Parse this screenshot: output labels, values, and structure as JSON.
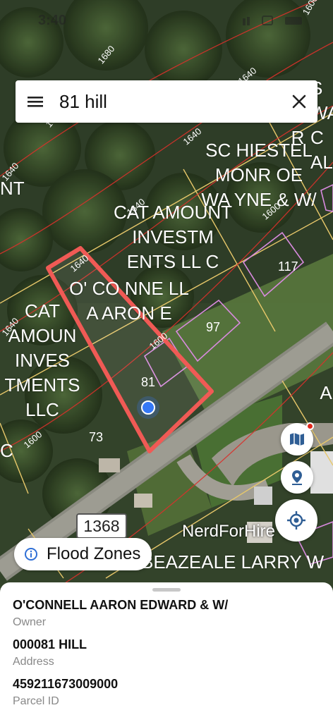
{
  "status_bar": {
    "time": "3:40"
  },
  "search": {
    "query": "81 hill",
    "menu_icon": "hamburger-menu-icon",
    "clear_icon": "close-icon"
  },
  "map": {
    "contour_labels": [
      "1680",
      "1640",
      "1640",
      "1640",
      "1640",
      "1600",
      "1600",
      "1600",
      "1600",
      "1640",
      "1640",
      "1640"
    ],
    "owner_labels": [
      "SC HIESTEL MONR OE WA YNE & W/",
      "CAT AMOUNT INVESTM ENTS LL C",
      "O' CO NNE LL A ARON E",
      "CAT AMOUN INVES TMENTS LLC",
      "NT",
      "S WA C AL",
      "R",
      "BEAZEALE LARRY W",
      "A",
      "C"
    ],
    "parcel_numbers": [
      "81",
      "97",
      "117",
      "73"
    ],
    "road_shield": "1368",
    "poi_label": "NerdForHire",
    "colors": {
      "selected_parcel": "#f05a55",
      "parcel_line": "#e8c86a",
      "contour": "#d9312b",
      "neighbor_parcel": "#d98adf",
      "location_dot": "#3478f6"
    }
  },
  "buttons": {
    "layers_icon": "map-layers-icon",
    "pin_icon": "location-pin-icon",
    "locate_icon": "my-location-crosshair-icon"
  },
  "flood_zones": {
    "label": "Flood Zones",
    "icon": "info-icon"
  },
  "parcel_sheet": {
    "owner_value": "O'CONNELL AARON EDWARD & W/",
    "owner_label": "Owner",
    "address_value": "000081 HILL",
    "address_label": "Address",
    "parcel_id_value": "459211673009000",
    "parcel_id_label": "Parcel ID"
  }
}
